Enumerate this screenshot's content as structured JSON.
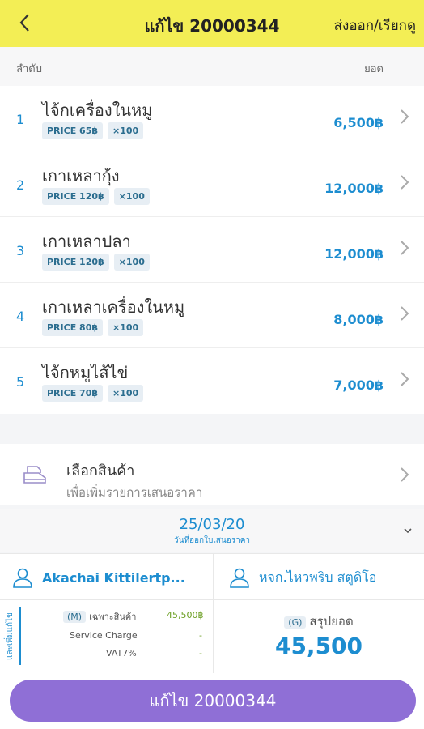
{
  "header": {
    "back_glyph": "‹",
    "title": "แก้ไข 20000344",
    "export_label": "ส่งออก/เรียกดู"
  },
  "columns": {
    "left": "ลำดับ",
    "right": "ยอด"
  },
  "items": [
    {
      "index": "1",
      "name": "ไจ้กเครื่องในหมู",
      "price": "PRICE 65฿",
      "qty": "×100",
      "amount": "6,500฿"
    },
    {
      "index": "2",
      "name": "เกาเหลากุ้ง",
      "price": "PRICE 120฿",
      "qty": "×100",
      "amount": "12,000฿"
    },
    {
      "index": "3",
      "name": "เกาเหลาปลา",
      "price": "PRICE 120฿",
      "qty": "×100",
      "amount": "12,000฿"
    },
    {
      "index": "4",
      "name": "เกาเหลาเครื่องในหมู",
      "price": "PRICE 80฿",
      "qty": "×100",
      "amount": "8,000฿"
    },
    {
      "index": "5",
      "name": "ไจ้กหมูไส้ไข่",
      "price": "PRICE 70฿",
      "qty": "×100",
      "amount": "7,000฿"
    }
  ],
  "add_product": {
    "title": "เลือกสินค้า",
    "subtitle": "เพื่อเพิ่มรายการเสนอราคา"
  },
  "date": {
    "value": "25/03/20",
    "label": "วันที่ออกใบเสนอราคา",
    "dropdown_glyph": "⌄"
  },
  "people": {
    "customer": "Akachai Kittilertp...",
    "company": "หจก.ไหวพริบ สตูดิโอ"
  },
  "summary": {
    "side_label": "และเพิ่มแก้ไข",
    "m_badge": "(M)",
    "m_label": "เฉพาะสินค้า",
    "m_value": "45,500฿",
    "service_label": "Service Charge",
    "service_value": "-",
    "vat_label": "VAT7%",
    "vat_value": "-",
    "g_badge": "(G)",
    "g_label": "สรุปยอด",
    "total": "45,500"
  },
  "bottom_button": "แก้ไข 20000344",
  "colors": {
    "header_bg": "#f3ee55",
    "accent_blue": "#1d8dd0",
    "button_purple": "#8f6fd6"
  }
}
